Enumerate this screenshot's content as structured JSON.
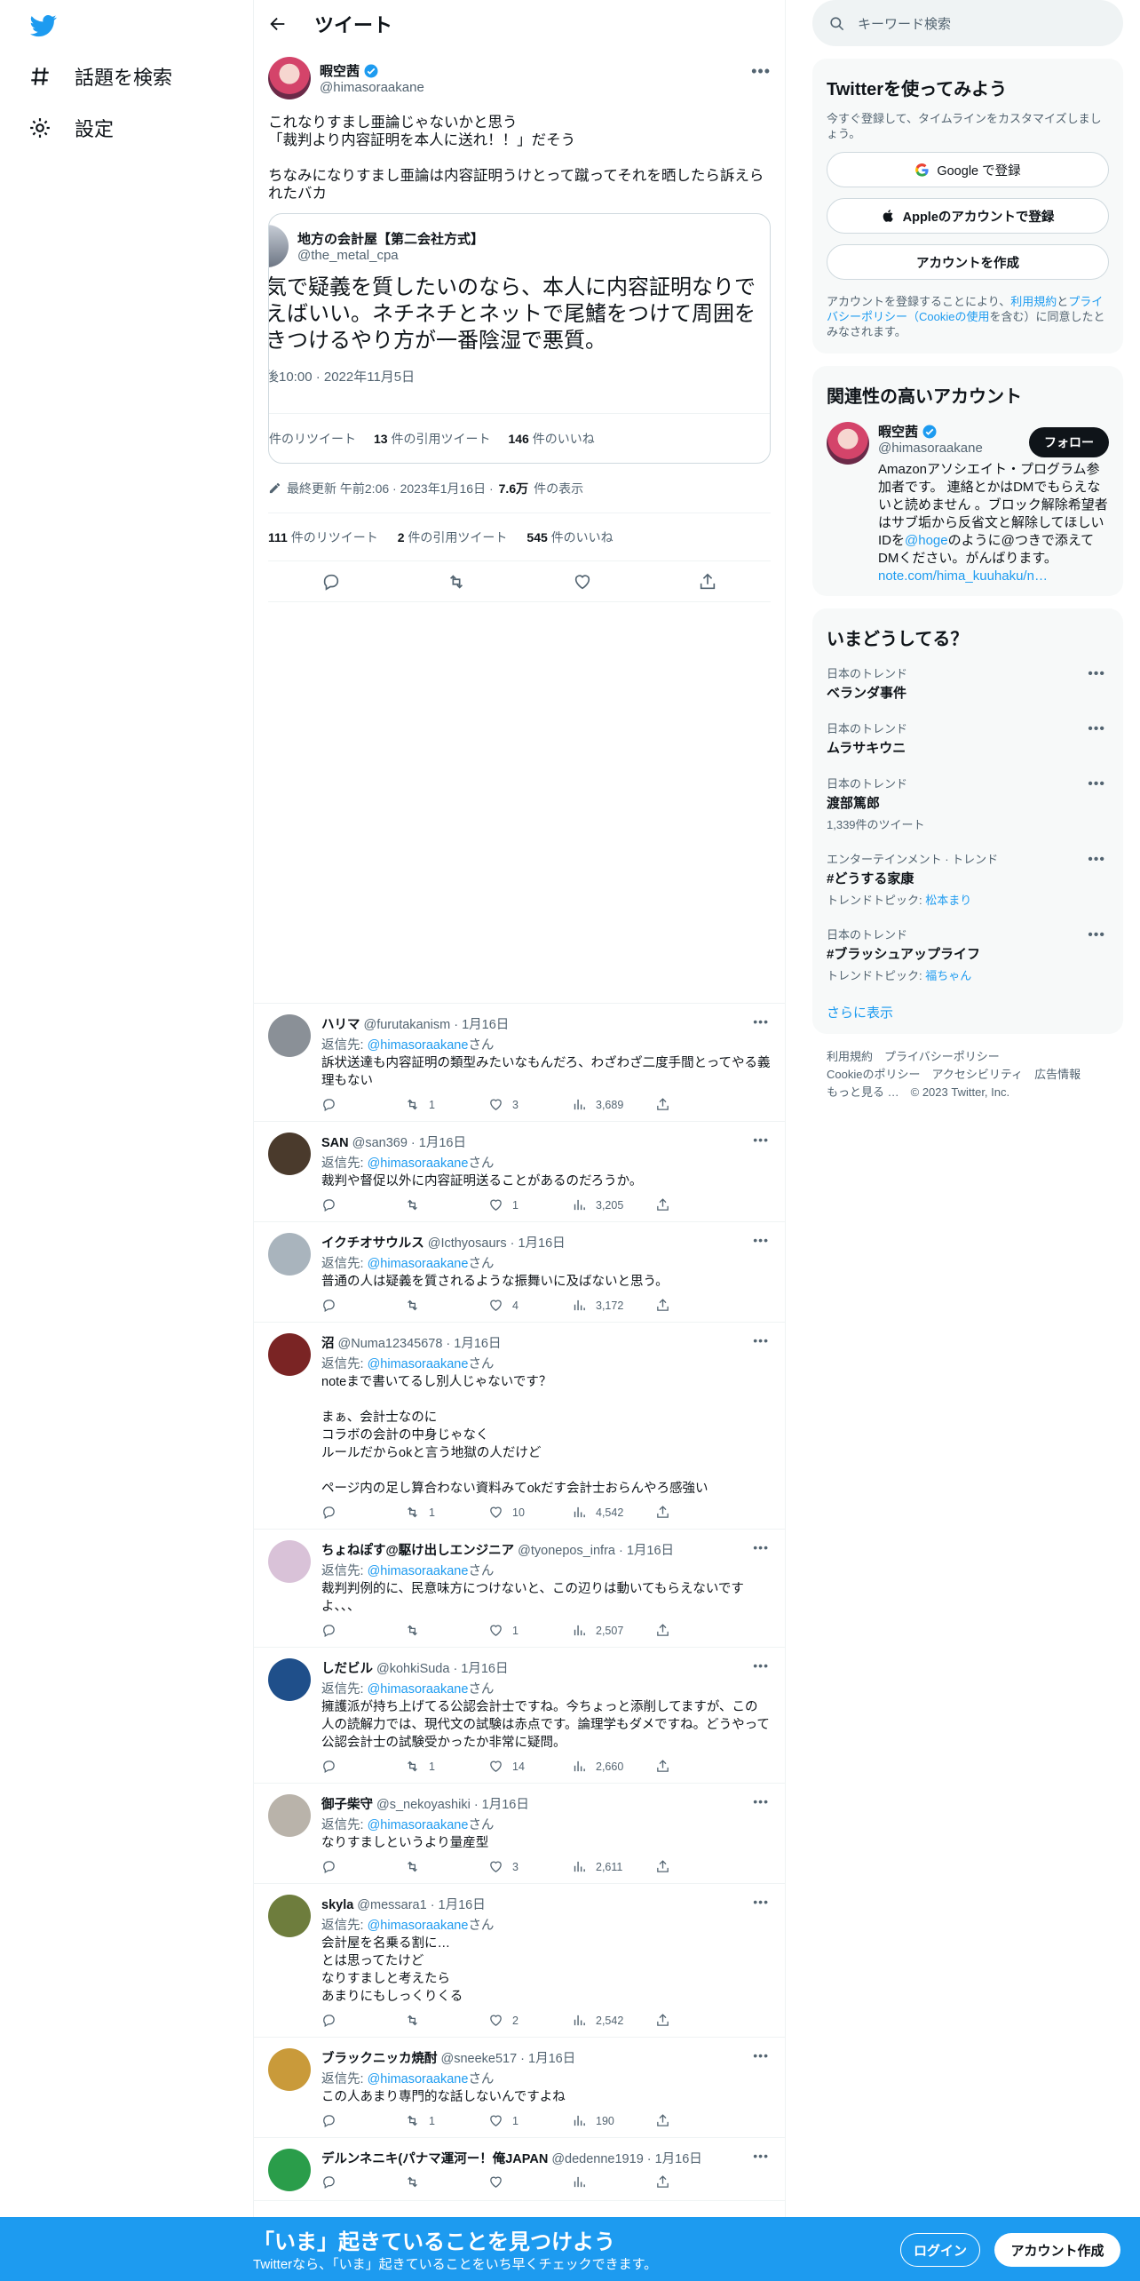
{
  "nav": {
    "explore_label": "話題を検索",
    "settings_label": "設定"
  },
  "header": {
    "title": "ツイート"
  },
  "focal_tweet": {
    "author_name": "暇空茜",
    "author_handle": "@himasoraakane",
    "text": "これなりすまし亜論じゃないかと思う\n「裁判より内容証明を本人に送れ！！」だそう\n\nちなみになりすまし亜論は内容証明うけとって蹴ってそれを晒したら訴えられたバカ",
    "quote": {
      "author_name": "地方の会計屋【第二会社方式】",
      "author_handle": "@the_metal_cpa",
      "text": "気で疑義を質したいのなら、本人に内容証明なりで\nえばいい。ネチネチとネットで尾鰭をつけて周囲を\nきつけるやり方が一番陰湿で悪質。",
      "time": "後10:00 · 2022年11月5日",
      "retweets_label": "件のリツイート",
      "quote_count": "13",
      "quote_label": "件の引用ツイート",
      "like_count": "146",
      "like_label": "件のいいね"
    },
    "edited_label": "最終更新 午前2:06 · 2023年1月16日 · ",
    "views_count": "7.6万",
    "views_label": "件の表示",
    "retweet_count": "111",
    "retweet_label": "件のリツイート",
    "quote_count": "2",
    "quote_label": "件の引用ツイート",
    "like_count": "545",
    "like_label": "件のいいね"
  },
  "replies": [
    {
      "name": "ハリマ",
      "handle": "@furutakanism",
      "date": "1月16日",
      "to_prefix": "返信先: ",
      "to_handle": "@himasoraakane",
      "to_suffix": "さん",
      "text": "訴状送達も内容証明の類型みたいなもんだろ、わざわざ二度手間とってやる義理もない",
      "retweets": "1",
      "likes": "3",
      "views": "3,689",
      "avatar_color": "#8a9097"
    },
    {
      "name": "SAN",
      "handle": "@san369",
      "date": "1月16日",
      "to_prefix": "返信先: ",
      "to_handle": "@himasoraakane",
      "to_suffix": "さん",
      "text": "裁判や督促以外に内容証明送ることがあるのだろうか。",
      "retweets": "",
      "likes": "1",
      "views": "3,205",
      "avatar_color": "#4a3a2c"
    },
    {
      "name": "イクチオサウルス",
      "handle": "@Icthyosaurs",
      "date": "1月16日",
      "to_prefix": "返信先: ",
      "to_handle": "@himasoraakane",
      "to_suffix": "さん",
      "text": "普通の人は疑義を質されるような振舞いに及ばないと思う。",
      "retweets": "",
      "likes": "4",
      "views": "3,172",
      "avatar_color": "#a9b4bd"
    },
    {
      "name": "沼",
      "handle": "@Numa12345678",
      "date": "1月16日",
      "to_prefix": "返信先: ",
      "to_handle": "@himasoraakane",
      "to_suffix": "さん",
      "text": "noteまで書いてるし別人じゃないです？\n\nまぁ、会計士なのに\nコラボの会計の中身じゃなく\nルールだからokと言う地獄の人だけど\n\nページ内の足し算合わない資料みてokだす会計士おらんやろ感強い",
      "retweets": "1",
      "likes": "10",
      "views": "4,542",
      "avatar_color": "#7a2424"
    },
    {
      "name": "ちょねぽす@駆け出しエンジニア",
      "handle": "@tyonepos_infra",
      "date": "1月16日",
      "to_prefix": "返信先: ",
      "to_handle": "@himasoraakane",
      "to_suffix": "さん",
      "text": "裁判判例的に、民意味方につけないと、この辺りは動いてもらえないですよ、、、",
      "retweets": "",
      "likes": "1",
      "views": "2,507",
      "avatar_color": "#d9c2d8"
    },
    {
      "name": "しだビル",
      "handle": "@kohkiSuda",
      "date": "1月16日",
      "to_prefix": "返信先: ",
      "to_handle": "@himasoraakane",
      "to_suffix": "さん",
      "text": "擁護派が持ち上げてる公認会計士ですね。今ちょっと添削してますが、この人の読解力では、現代文の試験は赤点です。論理学もダメですね。どうやって公認会計士の試験受かったか非常に疑問。",
      "retweets": "1",
      "likes": "14",
      "views": "2,660",
      "avatar_color": "#1f4f8a"
    },
    {
      "name": "御子柴守",
      "handle": "@s_nekoyashiki",
      "date": "1月16日",
      "to_prefix": "返信先: ",
      "to_handle": "@himasoraakane",
      "to_suffix": "さん",
      "text": "なりすましというより量産型",
      "retweets": "",
      "likes": "3",
      "views": "2,611",
      "avatar_color": "#b9b3aa"
    },
    {
      "name": "skyla",
      "handle": "@messara1",
      "date": "1月16日",
      "to_prefix": "返信先: ",
      "to_handle": "@himasoraakane",
      "to_suffix": "さん",
      "text": "会計屋を名乗る割に…\nとは思ってたけど\nなりすましと考えたら\nあまりにもしっくりくる",
      "retweets": "",
      "likes": "2",
      "views": "2,542",
      "avatar_color": "#6e7d3d"
    },
    {
      "name": "ブラックニッカ焼酎",
      "handle": "@sneeke517",
      "date": "1月16日",
      "to_prefix": "返信先: ",
      "to_handle": "@himasoraakane",
      "to_suffix": "さん",
      "text": "この人あまり専門的な話しないんですよね",
      "retweets": "1",
      "likes": "1",
      "views": "190",
      "avatar_color": "#c99a3a"
    },
    {
      "name": "デルンネニキ(パナマ運河ー！俺JAPAN",
      "handle": "@dedenne1919",
      "date": "1月16日",
      "to_prefix": "",
      "to_handle": "",
      "to_suffix": "",
      "text": "",
      "retweets": "",
      "likes": "",
      "views": "",
      "avatar_color": "#2a9d4a"
    }
  ],
  "right": {
    "search_placeholder": "キーワード検索",
    "signup_card": {
      "title": "Twitterを使ってみよう",
      "desc": "今すぐ登録して、タイムラインをカスタマイズしましょう。",
      "google_label": "Google で登録",
      "apple_label": "Appleのアカウントで登録",
      "create_label": "アカウントを作成",
      "legal_prefix": "アカウントを登録することにより、",
      "terms_link": "利用規約",
      "and": "と",
      "privacy_link": "プライバシーポリシー",
      "cookie_open": "（",
      "cookie_link": "Cookieの使用",
      "legal_suffix": "を含む）に同意したとみなされます。"
    },
    "related": {
      "title": "関連性の高いアカウント",
      "name": "暇空茜",
      "handle": "@himasoraakane",
      "follow_label": "フォロー",
      "bio_1": "Amazonアソシエイト・プログラム参加者です。 連絡とかはDMでもらえないと読めません 。ブロック解除希望者はサブ垢から反省文と解除してほしいIDを",
      "bio_link": "@hoge",
      "bio_2": "のように@つきで添えてDMください。がんばります。",
      "bio_url": "note.com/hima_kuuhaku/n…"
    },
    "trends": {
      "title": "いまどうしてる？",
      "items": [
        {
          "cat": "日本のトレンド",
          "name": "ベランダ事件",
          "sub": "",
          "sub_link": ""
        },
        {
          "cat": "日本のトレンド",
          "name": "ムラサキウニ",
          "sub": "",
          "sub_link": ""
        },
        {
          "cat": "日本のトレンド",
          "name": "渡部篤郎",
          "sub": "1,339件のツイート",
          "sub_link": ""
        },
        {
          "cat": "エンターテインメント · トレンド",
          "name": "#どうする家康",
          "sub": "トレンドトピック: ",
          "sub_link": "松本まり"
        },
        {
          "cat": "日本のトレンド",
          "name": "#ブラッシュアップライフ",
          "sub": "トレンドトピック: ",
          "sub_link": "福ちゃん"
        }
      ],
      "show_more": "さらに表示"
    },
    "footer": {
      "terms": "利用規約",
      "privacy": "プライバシーポリシー",
      "cookie": "Cookieのポリシー",
      "accessibility": "アクセシビリティ",
      "ads": "広告情報",
      "more": "もっと見る …",
      "copyright": "© 2023 Twitter, Inc."
    }
  },
  "bottom_bar": {
    "title": "「いま」起きていることを見つけよう",
    "subtitle": "Twitterなら、「いま」起きていることをいち早くチェックできます。",
    "login_label": "ログイン",
    "signup_label": "アカウント作成"
  }
}
